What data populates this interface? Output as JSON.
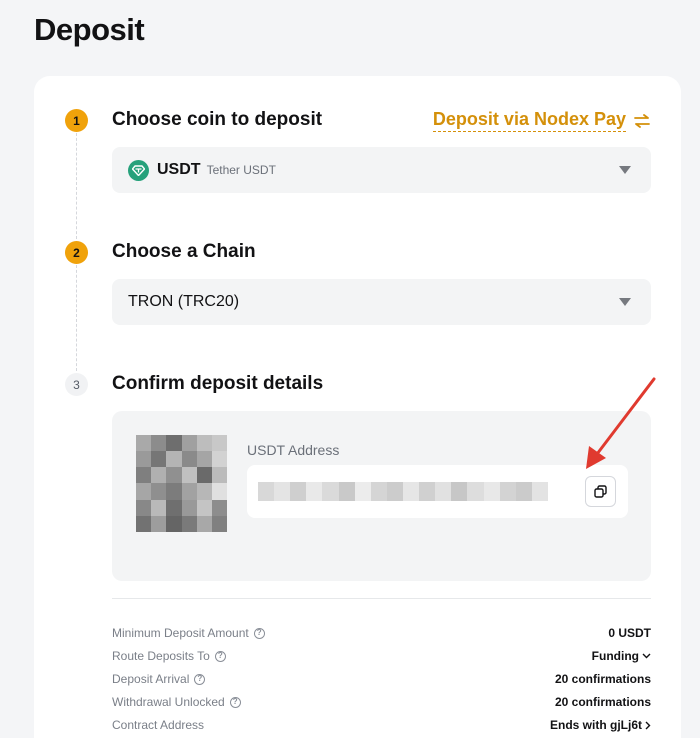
{
  "page": {
    "title": "Deposit"
  },
  "steps": [
    {
      "number": "1",
      "title": "Choose coin to deposit"
    },
    {
      "number": "2",
      "title": "Choose a Chain"
    },
    {
      "number": "3",
      "title": "Confirm deposit details"
    }
  ],
  "nodex_link": {
    "label": "Deposit via Nodex Pay",
    "icon": "swap-arrows-icon"
  },
  "coin_select": {
    "symbol": "USDT",
    "name": "Tether USDT",
    "icon": "tether-icon",
    "icon_color": "#26a17b"
  },
  "chain_select": {
    "value": "TRON (TRC20)"
  },
  "deposit": {
    "address_label": "USDT Address",
    "copy_icon": "copy-icon"
  },
  "details": [
    {
      "label": "Minimum Deposit Amount",
      "value": "0 USDT",
      "has_chevron": false
    },
    {
      "label": "Route Deposits To",
      "value": "Funding",
      "has_chevron": true,
      "chevron": "chevron-down-icon"
    },
    {
      "label": "Deposit Arrival",
      "value": "20 confirmations",
      "has_chevron": false
    },
    {
      "label": "Withdrawal Unlocked",
      "value": "20 confirmations",
      "has_chevron": false
    },
    {
      "label": "Contract Address",
      "value": "Ends with gjLj6t",
      "has_chevron": true,
      "chevron": "chevron-right-icon"
    }
  ],
  "colors": {
    "accent": "#f0a20b",
    "link": "#d4900a",
    "annotation_arrow": "#e03a2f"
  }
}
